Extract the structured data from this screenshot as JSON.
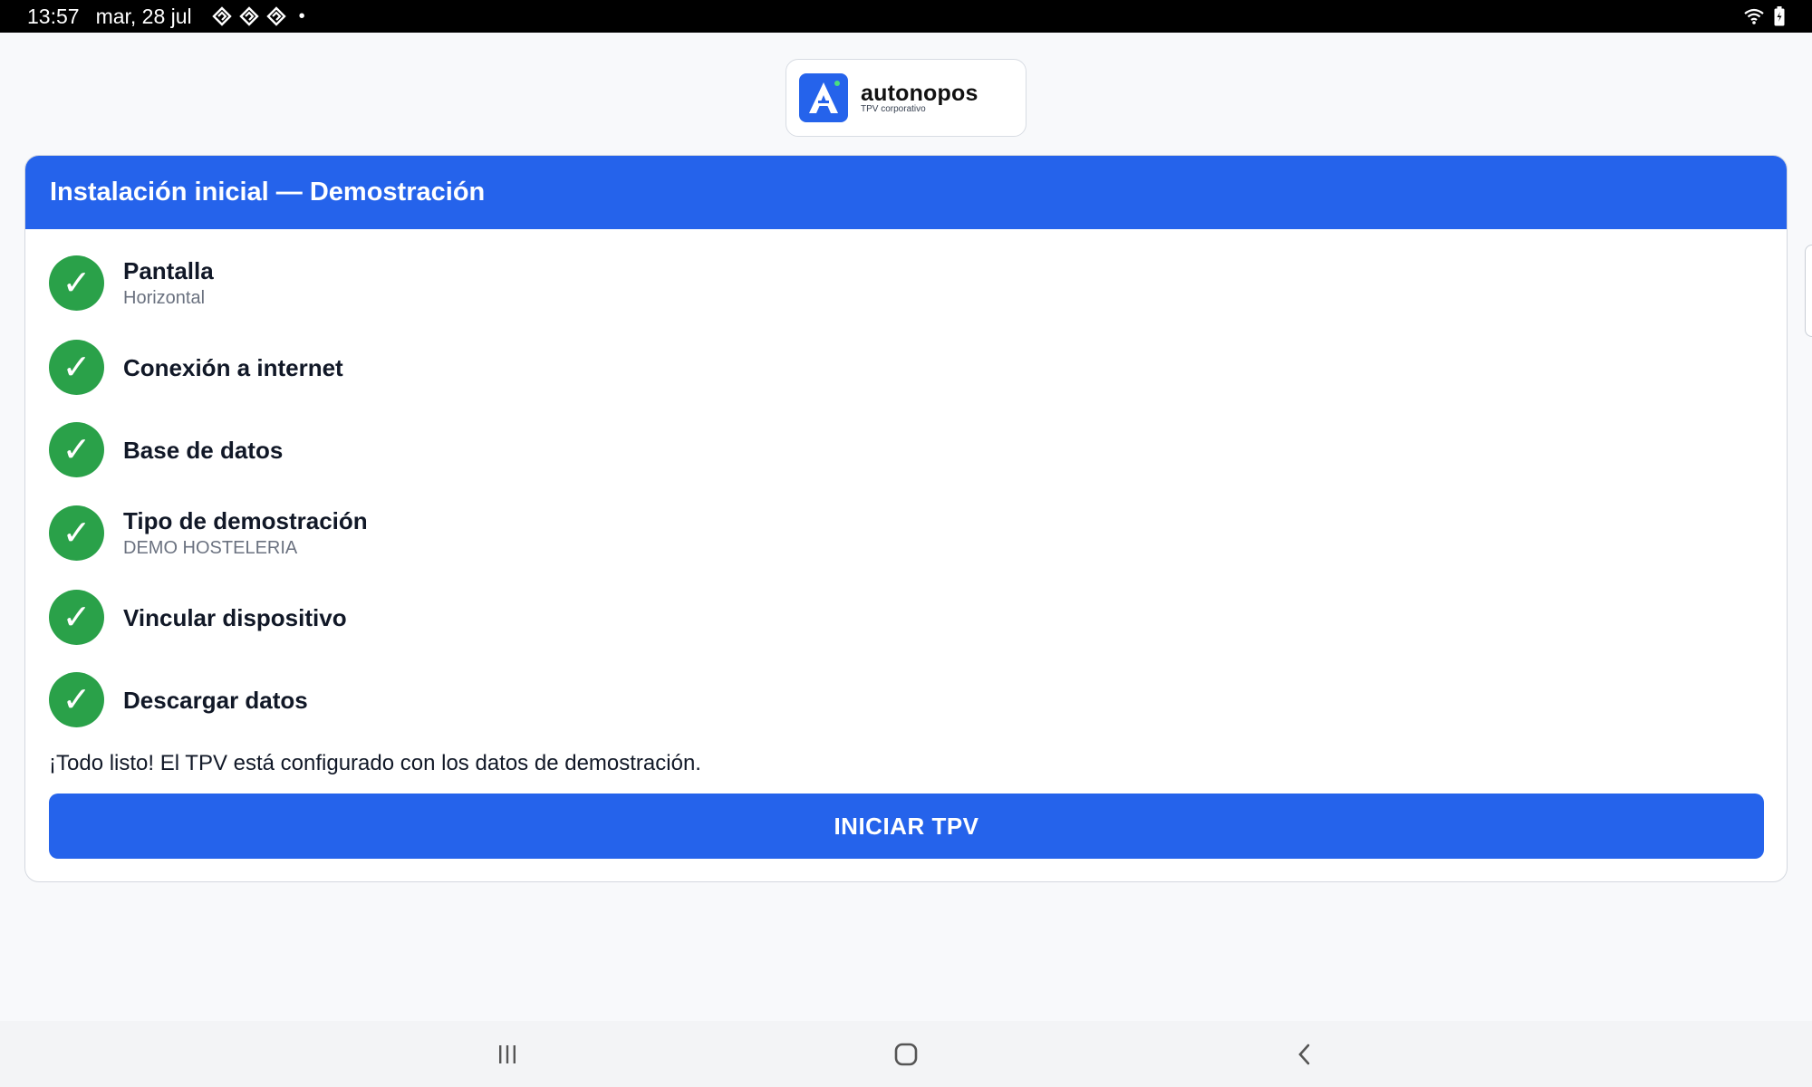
{
  "status_bar": {
    "time": "13:57",
    "date": "mar, 28 jul",
    "notification_icons": [
      "app-notification-icon",
      "app-notification-icon",
      "app-notification-icon"
    ],
    "dot": "•",
    "right_icons": [
      "wifi-icon",
      "battery-icon"
    ]
  },
  "logo": {
    "mark_letter": "A",
    "name": "autonopos",
    "tagline": "TPV corporativo"
  },
  "panel": {
    "title": "Instalación inicial — Demostración",
    "steps": [
      {
        "title": "Pantalla",
        "subtitle": "Horizontal",
        "status_icon": "check-icon"
      },
      {
        "title": "Conexión a internet",
        "subtitle": "",
        "status_icon": "check-icon"
      },
      {
        "title": "Base de datos",
        "subtitle": "",
        "status_icon": "check-icon"
      },
      {
        "title": "Tipo de demostración",
        "subtitle": "DEMO HOSTELERIA",
        "status_icon": "check-icon"
      },
      {
        "title": "Vincular dispositivo",
        "subtitle": "",
        "status_icon": "check-icon"
      },
      {
        "title": "Descargar datos",
        "subtitle": "",
        "status_icon": "check-icon"
      }
    ],
    "message": "¡Todo listo! El TPV está configurado con los datos de demostración.",
    "start_button": "INICIAR TPV"
  },
  "nav_bar": {
    "buttons": [
      "recents-icon",
      "home-icon",
      "back-icon"
    ]
  },
  "colors": {
    "primary": "#2563eb",
    "success": "#2aa149",
    "background": "#f8f9fb"
  }
}
